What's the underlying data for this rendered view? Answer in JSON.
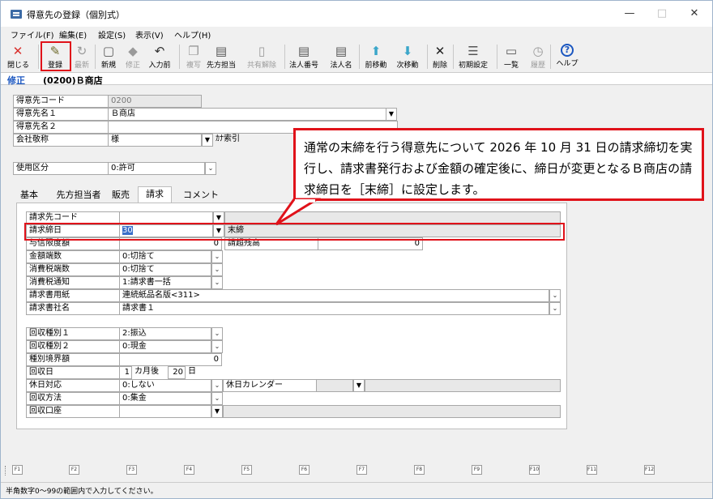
{
  "window": {
    "title": "得意先の登録（個別式）",
    "minimize": "—",
    "maximize": "□",
    "close": "✕"
  },
  "menu": [
    "ファイル(F)",
    "編集(E)",
    "設定(S)",
    "表示(V)",
    "ヘルプ(H)"
  ],
  "toolbar": [
    {
      "label": "閉じる",
      "icon": "close-icon",
      "glyph": "✕",
      "color": "#d9302c",
      "enabled": true
    },
    {
      "label": "登録",
      "icon": "save-icon",
      "glyph": "✎",
      "color": "#6e6a2a",
      "enabled": true
    },
    {
      "label": "最新",
      "icon": "refresh-icon",
      "glyph": "↻",
      "color": "#9a9a9a",
      "enabled": false
    },
    {
      "label": "新規",
      "icon": "new-document-icon",
      "glyph": "▢",
      "color": "#5a5a5a",
      "enabled": true
    },
    {
      "label": "修正",
      "icon": "erase-icon",
      "glyph": "◆",
      "color": "#9a9a9a",
      "enabled": false
    },
    {
      "label": "入力前",
      "icon": "undo-icon",
      "glyph": "↶",
      "color": "#333333",
      "enabled": true
    },
    {
      "label": "複写",
      "icon": "copy-icon",
      "glyph": "❐",
      "color": "#9a9a9a",
      "enabled": false
    },
    {
      "label": "先方担当",
      "icon": "contact-icon",
      "glyph": "▤",
      "color": "#555555",
      "enabled": true
    },
    {
      "label": "共有解除",
      "icon": "unshare-icon",
      "glyph": "▯",
      "color": "#9a9a9a",
      "enabled": false
    },
    {
      "label": "法人番号",
      "icon": "corporate-number-icon",
      "glyph": "▤",
      "color": "#555555",
      "enabled": true
    },
    {
      "label": "法人名",
      "icon": "corporate-name-icon",
      "glyph": "▤",
      "color": "#555555",
      "enabled": true
    },
    {
      "label": "前移動",
      "icon": "arrow-up-icon",
      "glyph": "⬆",
      "color": "#3aa6c9",
      "enabled": true
    },
    {
      "label": "次移動",
      "icon": "arrow-down-icon",
      "glyph": "⬇",
      "color": "#3aa6c9",
      "enabled": true
    },
    {
      "label": "削除",
      "icon": "delete-icon",
      "glyph": "✕",
      "color": "#222222",
      "enabled": true
    },
    {
      "label": "初期設定",
      "icon": "settings-list-icon",
      "glyph": "☰",
      "color": "#555555",
      "enabled": true
    },
    {
      "label": "一覧",
      "icon": "list-icon",
      "glyph": "▭",
      "color": "#555555",
      "enabled": true
    },
    {
      "label": "履歴",
      "icon": "history-icon",
      "glyph": "◷",
      "color": "#9a9a9a",
      "enabled": false
    },
    {
      "label": "ヘルプ",
      "icon": "help-icon",
      "glyph": "?",
      "color": "#1a56c0",
      "enabled": true
    }
  ],
  "mode": {
    "label": "修正",
    "record": "(0200)Ｂ商店"
  },
  "header_fields": {
    "code_label": "得意先コード",
    "code_value": "0200",
    "name1_label": "得意先名１",
    "name1_value": "Ｂ商店",
    "name2_label": "得意先名２",
    "name2_value": "",
    "honorific_label": "会社敬称",
    "honorific_value": "様",
    "kana_label": "ｶﾅ索引",
    "usage_label": "使用区分",
    "usage_value": "0:許可"
  },
  "tabs": [
    "基本",
    "先方担当者",
    "販売",
    "請求",
    "コメント"
  ],
  "active_tab": "請求",
  "billing": {
    "billing_code_label": "請求先コード",
    "billing_code_value": "",
    "closing_day_label": "請求締日",
    "closing_day_value": "30",
    "closing_day_text": "末締",
    "credit_label": "与信限度額",
    "credit_value": "0",
    "balance_label": "請超残高",
    "balance_value": "0",
    "amount_rounding_label": "金額端数",
    "amount_rounding_value": "0:切捨て",
    "tax_rounding_label": "消費税端数",
    "tax_rounding_value": "0:切捨て",
    "tax_notice_label": "消費税通知",
    "tax_notice_value": "1:請求書一括",
    "form_label": "請求書用紙",
    "form_value": "連続紙品名版<311>",
    "company_label": "請求書社名",
    "company_value": "請求書１",
    "collect1_label": "回収種別１",
    "collect1_value": "2:振込",
    "collect2_label": "回収種別２",
    "collect2_value": "0:現金",
    "threshold_label": "種別境界額",
    "threshold_value": "0",
    "collect_day_label": "回収日",
    "collect_month": "1",
    "collect_month_unit": "カ月後",
    "collect_day": "20",
    "collect_day_unit": "日",
    "holiday_label": "休日対応",
    "holiday_value": "0:しない",
    "calendar_label": "休日カレンダー",
    "method_label": "回収方法",
    "method_value": "0:集金",
    "account_label": "回収口座",
    "account_value": ""
  },
  "callout": "通常の末締を行う得意先について 2026 年 10 月 31 日の請求締切を実行し、請求書発行および金額の確定後に、締日が変更となるＢ商店の請求締日を［末締］に設定します。",
  "fkeys": [
    "F1",
    "F2",
    "F3",
    "F4",
    "F5",
    "F6",
    "F7",
    "F8",
    "F9",
    "F10",
    "F11",
    "F12"
  ],
  "status": "半角数字0～99の範囲内で入力してください。",
  "colors": {
    "highlight": "#e0121a",
    "mode_label": "#1a56c0"
  }
}
